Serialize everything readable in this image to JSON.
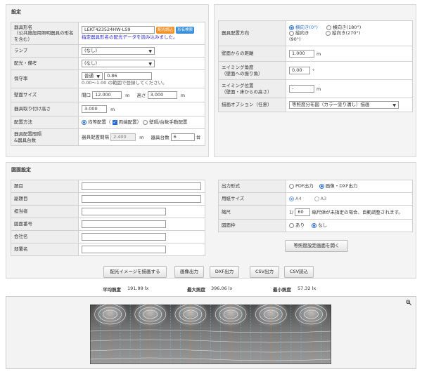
{
  "equipment": {
    "title": "設定",
    "model_label": "器具形名\n（公共施設用照明器具の形名を含む）",
    "model_value": "LEKT423524HW-LS9",
    "badge_dist": "配光読込",
    "badge_search": "形名検索",
    "model_note": "指定器具形名の配光データを読み込みました。",
    "lamp_label": "ランプ",
    "lamp_value": "(なし)",
    "light_label": "配光・備考",
    "light_value": "(なし)",
    "maint_label": "保守率",
    "maint_select": "普通",
    "maint_value": "0.86",
    "maint_note": "0.00～1.00 の範囲で登録してください。",
    "wall_label": "壁面サイズ",
    "width_prefix": "間口",
    "width_value": "12.000",
    "unit_m": "m",
    "height_prefix": "高さ",
    "height_value": "3.000",
    "mount_label": "器具取り付け高さ",
    "mount_value": "3.000",
    "layout_label": "配置方法",
    "layout_even": "均等配置（",
    "layout_both": "両端配置",
    "layout_close": "）",
    "layout_manual": "壁隔/台数手動配置",
    "spacing_label": "器具配置間隔\n&器具台数",
    "spacing_prefix": "器具配置間隔",
    "spacing_value": "2.400",
    "count_prefix": "器具台数",
    "count_value": "6",
    "count_unit": "台"
  },
  "orientation": {
    "dir_label": "器具配置方向",
    "opt_h0": "横向き(0°)",
    "opt_h180": "横向き(180°)",
    "opt_v90": "縦向き\n(90°)",
    "opt_v270": "縦向き(270°)",
    "dist_label": "壁面からの距離",
    "dist_value": "1.000",
    "aim_label": "エイミング角度\n（壁面への振り角）",
    "aim_value": "0.00",
    "deg": "°",
    "aimpos_label": "エイミング位置\n（壁面・床からの高さ）",
    "aimpos_value": "-",
    "draw_label": "描画オプション（任意）",
    "draw_value": "等照度分布図（カラー塗り潰し）描画"
  },
  "drawing": {
    "title": "図面設定",
    "fields": [
      {
        "label": "題目"
      },
      {
        "label": "副題目"
      },
      {
        "label": "担当者"
      },
      {
        "label": "図面番号"
      },
      {
        "label": "会社名"
      },
      {
        "label": "部署名"
      }
    ],
    "output_label": "出力形式",
    "output_pdf": "PDF出力",
    "output_img": "画像・DXF出力",
    "paper_label": "用紙サイズ",
    "paper_a4": "A4",
    "paper_a3": "A3",
    "scale_label": "縮尺",
    "scale_prefix": "1/",
    "scale_value": "60",
    "scale_note": "縮尺値が未指定の場合、自動調整されます。",
    "frame_label": "図面枠",
    "frame_on": "あり",
    "frame_off": "なし",
    "iso_button": "等照度設定画面を開く"
  },
  "actions": {
    "draw": "配光イメージを描画する",
    "img": "画像出力",
    "dxf": "DXF出力",
    "csv_out": "CSV出力",
    "csv_in": "CSV読込"
  },
  "stats": {
    "avg_label": "平均照度",
    "avg_value": "191.99 lx",
    "max_label": "最大照度",
    "max_value": "396.06 lx",
    "min_label": "最小照度",
    "min_value": "57.32 lx"
  },
  "colors": {
    "accent": "#2a6fd6",
    "badge_orange": "#f0922a",
    "badge_blue": "#3a8fd8"
  }
}
